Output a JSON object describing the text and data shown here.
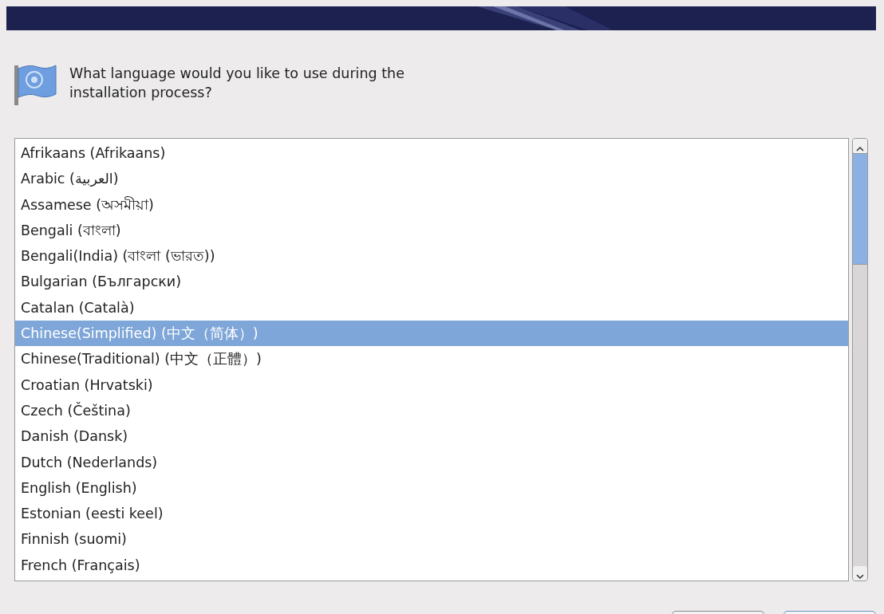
{
  "prompt": {
    "text": "What language would you like to use during the installation process?"
  },
  "languages": [
    {
      "label": "Afrikaans (Afrikaans)",
      "selected": false
    },
    {
      "label": "Arabic (العربية)",
      "selected": false
    },
    {
      "label": "Assamese (অসমীয়া)",
      "selected": false
    },
    {
      "label": "Bengali (বাংলা)",
      "selected": false
    },
    {
      "label": "Bengali(India) (বাংলা (ভারত))",
      "selected": false
    },
    {
      "label": "Bulgarian (Български)",
      "selected": false
    },
    {
      "label": "Catalan (Català)",
      "selected": false
    },
    {
      "label": "Chinese(Simplified) (中文（简体）)",
      "selected": true
    },
    {
      "label": "Chinese(Traditional) (中文（正體）)",
      "selected": false
    },
    {
      "label": "Croatian (Hrvatski)",
      "selected": false
    },
    {
      "label": "Czech (Čeština)",
      "selected": false
    },
    {
      "label": "Danish (Dansk)",
      "selected": false
    },
    {
      "label": "Dutch (Nederlands)",
      "selected": false
    },
    {
      "label": "English (English)",
      "selected": false
    },
    {
      "label": "Estonian (eesti keel)",
      "selected": false
    },
    {
      "label": "Finnish (suomi)",
      "selected": false
    },
    {
      "label": "French (Français)",
      "selected": false
    }
  ]
}
